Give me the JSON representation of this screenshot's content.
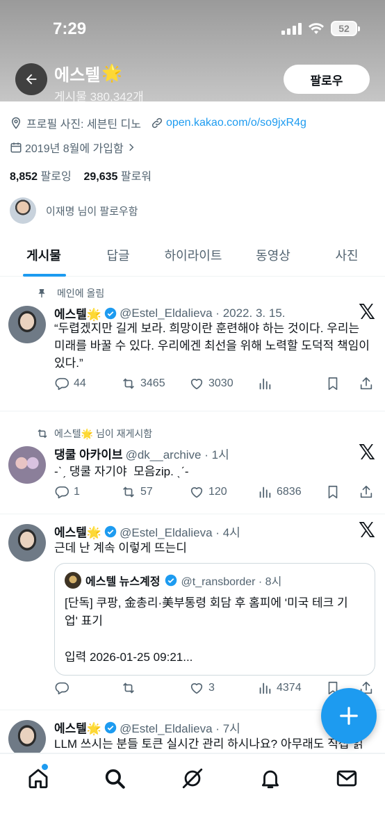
{
  "status_bar": {
    "time": "7:29",
    "battery": "52"
  },
  "header": {
    "name": "에스텔",
    "name_emoji": "🌟",
    "post_count": "게시물 380,342개",
    "follow_label": "팔로우"
  },
  "profile": {
    "photo_credit": "프로필 사진: 세븐틴 디노",
    "link": "open.kakao.com/o/so9jxR4g",
    "joined": "2019년 8월에 가입함",
    "following_count": "8,852",
    "following_label": "팔로잉",
    "followers_count": "29,635",
    "followers_label": "팔로워",
    "followed_by": "이재명 님이 팔로우함"
  },
  "tabs": [
    {
      "label": "게시물"
    },
    {
      "label": "답글"
    },
    {
      "label": "하이라이트"
    },
    {
      "label": "동영상"
    },
    {
      "label": "사진"
    }
  ],
  "posts": [
    {
      "context": "메인에 올림",
      "name": "에스텔🌟",
      "handle": "@Estel_Eldalieva · 2022. 3. 15.",
      "text": "“두렵겠지만 길게 보라. 희망이란 훈련해야 하는 것이다. 우리는\n미래를 바꿀 수 있다. 우리에겐 최선을 위해 노력할 도덕적 책임이\n있다.”",
      "replies": "44",
      "reposts": "3465",
      "likes": "3030",
      "views": ""
    },
    {
      "context": "에스텔🌟 님이 재게시함",
      "name": "댕쿨 아카이브",
      "handle": "@dk__archive · 1시",
      "text": "-ˋˏ 댕쿨 자기야  모음zip. ˎˊ-",
      "replies": "1",
      "reposts": "57",
      "likes": "120",
      "views": "6836"
    },
    {
      "name": "에스텔🌟",
      "handle": "@Estel_Eldalieva · 4시",
      "text": "근데 난 계속 이렇게 뜨는디",
      "quote": {
        "name": "에스텔 뉴스계정",
        "handle": "@t_ransborder · 8시",
        "text": "[단독] 쿠팡, 金총리·美부통령 회담 후 홈피에 '미국 테크 기\n업' 표기\n\n입력 2026-01-25 09:21..."
      },
      "replies": "",
      "reposts": "",
      "likes": "3",
      "views": "4374"
    },
    {
      "name": "에스텔🌟",
      "handle": "@Estel_Eldalieva · 7시",
      "text": "LLM 쓰시는 분들 토큰 실시간 관리 하시나요? 아무래도 직접 읽"
    }
  ],
  "colors": {
    "accent": "#1d9bf0",
    "secondary_text": "#536471"
  },
  "bottom_nav": [
    "home-icon",
    "search-icon",
    "grok-icon",
    "notifications-icon",
    "messages-icon"
  ]
}
